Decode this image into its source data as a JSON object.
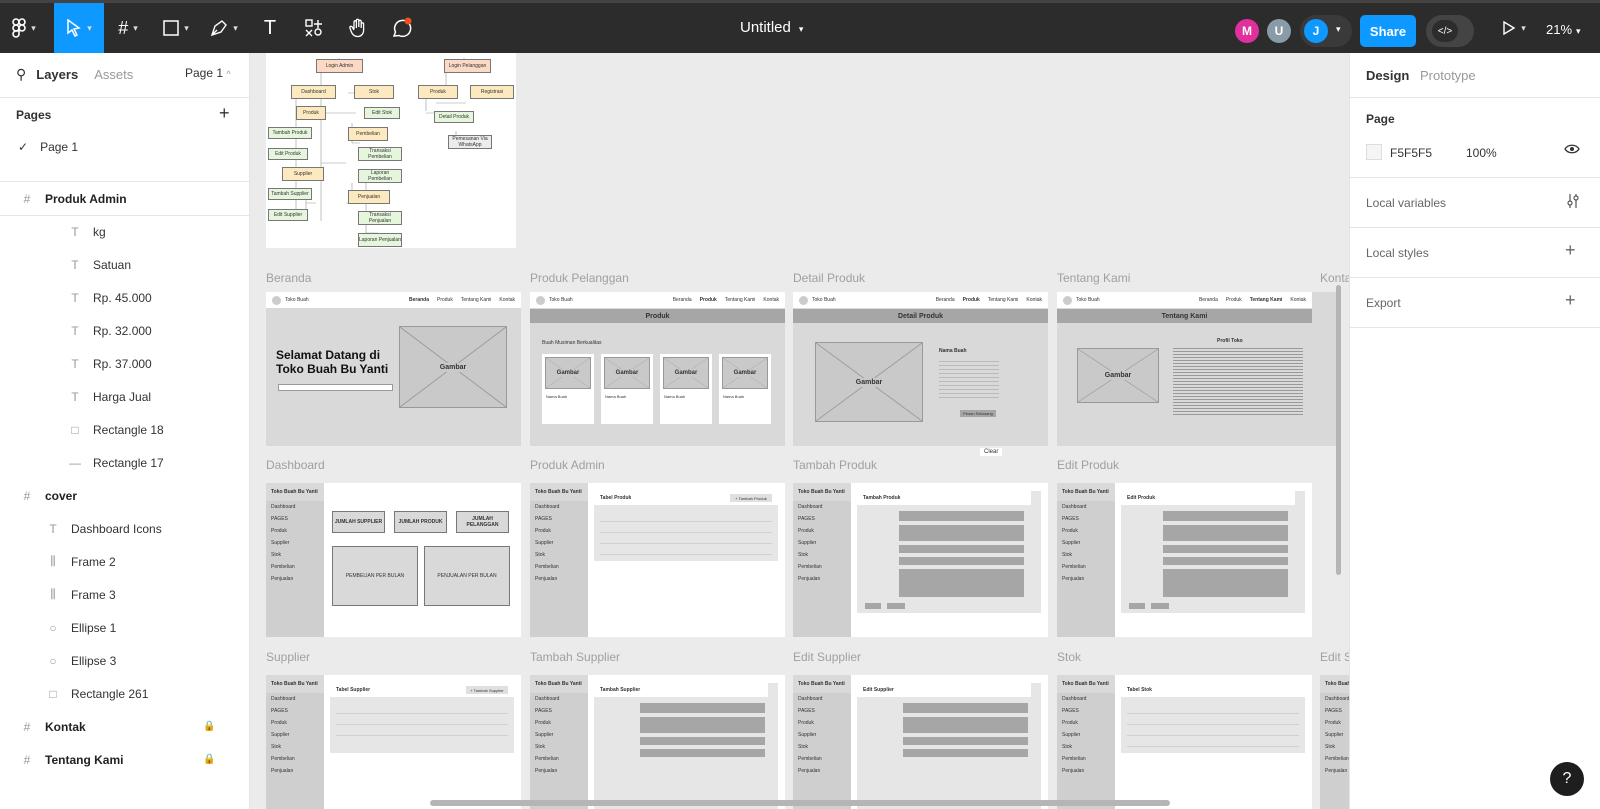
{
  "toolbar": {
    "doc_title": "Untitled",
    "share_label": "Share",
    "zoom": "21%",
    "avatars": [
      {
        "initial": "M",
        "color": "#e0309e"
      },
      {
        "initial": "U",
        "color": "#8a9ba8"
      },
      {
        "initial": "J",
        "color": "#0d99ff"
      }
    ],
    "dev_mode_icon": "</>",
    "accent": "#0d99ff"
  },
  "left_panel": {
    "tab_layers": "Layers",
    "tab_assets": "Assets",
    "page_selector": "Page 1",
    "pages_title": "Pages",
    "pages": [
      "Page 1"
    ],
    "layers": [
      {
        "name": "Produk Admin",
        "type": "frame",
        "bold": true
      },
      {
        "name": "kg",
        "type": "text"
      },
      {
        "name": "Satuan",
        "type": "text"
      },
      {
        "name": "Rp. 45.000",
        "type": "text"
      },
      {
        "name": "Rp. 32.000",
        "type": "text"
      },
      {
        "name": "Rp. 37.000",
        "type": "text"
      },
      {
        "name": "Harga Jual",
        "type": "text"
      },
      {
        "name": "Rectangle 18",
        "type": "rect"
      },
      {
        "name": "Rectangle 17",
        "type": "line"
      },
      {
        "name": "cover",
        "type": "frame",
        "bold": true
      },
      {
        "name": "Dashboard Icons",
        "type": "text"
      },
      {
        "name": "Frame 2",
        "type": "autolayout"
      },
      {
        "name": "Frame 3",
        "type": "autolayout"
      },
      {
        "name": "Ellipse 1",
        "type": "ellipse"
      },
      {
        "name": "Ellipse 3",
        "type": "ellipse"
      },
      {
        "name": "Rectangle 261",
        "type": "rect"
      },
      {
        "name": "Kontak",
        "type": "frame",
        "bold": true,
        "locked": true
      },
      {
        "name": "Tentang Kami",
        "type": "frame",
        "bold": true,
        "locked": true
      }
    ]
  },
  "right_panel": {
    "tab_design": "Design",
    "tab_prototype": "Prototype",
    "page_title": "Page",
    "page_color": "F5F5F5",
    "page_opacity": "100%",
    "local_variables": "Local variables",
    "local_styles": "Local styles",
    "export": "Export"
  },
  "canvas": {
    "frame_labels": {
      "beranda": "Beranda",
      "produk_pelanggan": "Produk Pelanggan",
      "detail_produk": "Detail Produk",
      "tentang_kami": "Tentang Kami",
      "kontak": "Konta",
      "dashboard": "Dashboard",
      "produk_admin": "Produk Admin",
      "tambah_produk": "Tambah Produk",
      "edit_produk": "Edit Produk",
      "supplier": "Supplier",
      "tambah_supplier": "Tambah Supplier",
      "edit_supplier": "Edit Supplier",
      "stok": "Stok",
      "edit_s": "Edit S"
    },
    "flow": {
      "login_admin": "Login Admin",
      "login_pelanggan": "Login Pelanggan",
      "dashboard": "Dashboard",
      "stok": "Stok",
      "edit_stok": "Edit Stok",
      "produk": "Produk",
      "pembelian": "Pembelian",
      "tambah_produk": "Tambah Produk",
      "transaksi_pembelian": "Transaksi Pembelian",
      "edit_produk": "Edit Produk",
      "laporan_pembelian": "Laporan Pembelian",
      "supplier": "Supplier",
      "penjualan": "Penjualan",
      "tambah_supplier": "Tambah Supplier",
      "transaksi_penjualan": "Transaksi Penjualan",
      "edit_supplier": "Edit Supplier",
      "laporan_penjualan": "Laporan Penjualan",
      "produk_p": "Produk",
      "registrasi": "Registrasi",
      "detail_produk": "Detail Produk",
      "pemesanan_wa": "Pemesanan Via WhatsApp"
    },
    "wire": {
      "brand": "Toko Buah",
      "nav_links": [
        "Beranda",
        "Produk",
        "Tentang Kami",
        "Kontak"
      ],
      "hero_title": "Selamat Datang di Toko Buah Bu Yanti",
      "image_label": "Gambar",
      "produk_heading": "Produk",
      "produk_sub": "Buah Musiman Berkualitas",
      "card_name": "Nama Buah",
      "detail_heading": "Detail Produk",
      "detail_name": "Nama Buah",
      "detail_button": "Pesan Sekarang",
      "tentang_heading": "Tentang Kami",
      "profil_title": "Profil Toko",
      "admin_brand": "Toko Buah Bu Yanti",
      "sidebar": [
        "Dashboard",
        "PAGES",
        "Produk",
        "Supplier",
        "Stok",
        "Pembelian",
        "Penjualan"
      ],
      "dash_cards": [
        "JUMLAH SUPPLIER",
        "JUMLAH PRODUK",
        "JUMLAH PELANGGAN"
      ],
      "dash_big": [
        "PEMBELIAN PER BULAN",
        "PENJUALAN PER BULAN"
      ],
      "tabel_produk": "Tabel Produk",
      "tambah_produk_btn": "+ Tambah Produk",
      "tambah_produk_hdr": "Tambah Produk",
      "edit_produk_hdr": "Edit Produk",
      "tabel_supplier": "Tabel Supplier",
      "tambah_supplier_btn": "+ Tambah Supplier",
      "tambah_supplier_hdr": "Tambah Supplier",
      "edit_supplier_hdr": "Edit Supplier",
      "tabel_stok": "Tabel Stok",
      "clear_label": "Clear"
    }
  }
}
